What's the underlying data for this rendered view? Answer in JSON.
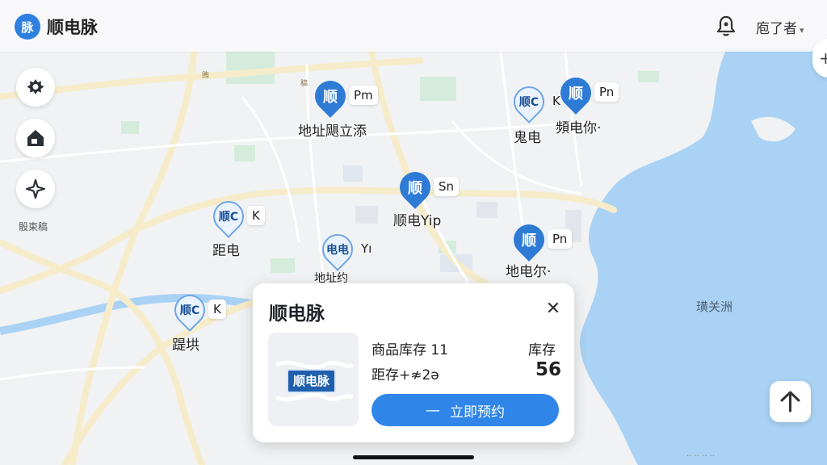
{
  "header": {
    "logo_char": "脉",
    "app_name": "顺电脉",
    "user_name": "庖了者",
    "user_caret": "▾"
  },
  "left_controls": {
    "caption": "骰束稿"
  },
  "map": {
    "sea_label": "璜关洲",
    "road_label_1": "贿",
    "road_label_2": "稿",
    "attribution": "·· ·· ·· ··",
    "pins": [
      {
        "style": "dark",
        "head": "顺",
        "tag": "Pm",
        "label": "地址飓立添"
      },
      {
        "style": "light",
        "head": "顺C",
        "tag": "K",
        "label": "鬼电"
      },
      {
        "style": "dark",
        "head": "顺",
        "tag": "Pn",
        "label": "頻电你·"
      },
      {
        "style": "dark",
        "head": "顺",
        "tag": "Sn",
        "label": "顺电Yip"
      },
      {
        "style": "light",
        "head": "顺C",
        "tag": "K",
        "label": "距电"
      },
      {
        "style": "light",
        "head": "电电",
        "tag": "Yı",
        "label": "地址约"
      },
      {
        "style": "dark",
        "head": "顺",
        "tag": "Pn",
        "label": "地电尔·"
      },
      {
        "style": "light",
        "head": "顺C",
        "tag": "K",
        "label": "踶垬"
      }
    ]
  },
  "card": {
    "title": "顺电脉",
    "close_label": "✕",
    "thumbnail_text": "顺电脉",
    "stock_label": "商品库存 11",
    "distance_label": "距存+≉2ə",
    "stock_header": "库存",
    "stock_value": "56",
    "reserve_dash": "—",
    "reserve_label": "立即预约"
  },
  "colors": {
    "accent": "#2f86e8",
    "pin_dark": "#2e7bd6",
    "water": "#a9d2f4",
    "park": "#cfe8d6"
  }
}
